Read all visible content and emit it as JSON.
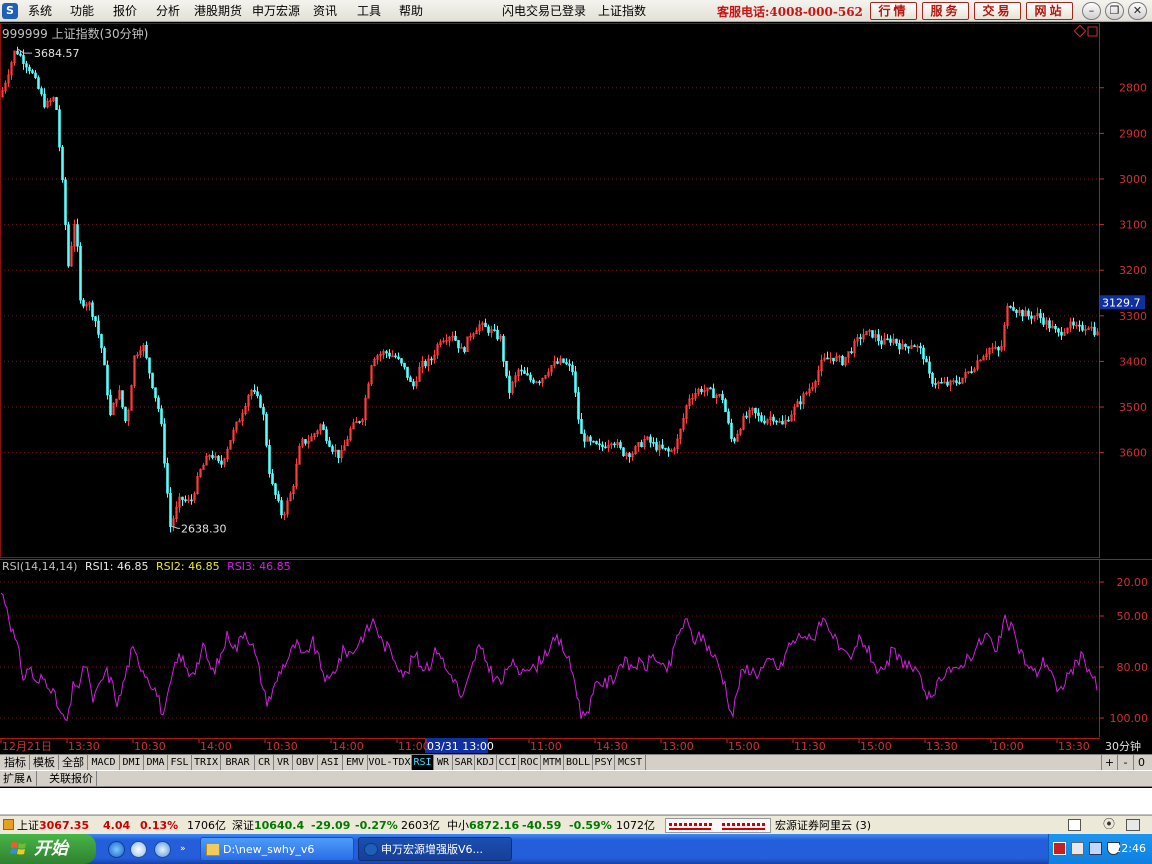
{
  "menubar": {
    "items": [
      "系统",
      "功能",
      "报价",
      "分析",
      "港股期货",
      "申万宏源",
      "资讯",
      "工具",
      "帮助"
    ],
    "status_login": "闪电交易已登录",
    "status_index": "上证指数",
    "hotline": "客服电话:4008-000-562",
    "buttons": [
      "行情",
      "服务",
      "交易",
      "网站"
    ]
  },
  "chart": {
    "title": "999999 上证指数(30分钟)",
    "high_label": "3684.57",
    "low_label": "2638.30",
    "last_price": "3129.7",
    "y_ticks": [
      "3600",
      "3500",
      "3400",
      "3300",
      "3200",
      "3100",
      "3000",
      "2900",
      "2800"
    ]
  },
  "chart_data": [
    {
      "type": "candlestick",
      "title": "999999 上证指数(30分钟)",
      "ylim": [
        2580,
        3720
      ],
      "y_ticks": [
        2800,
        2900,
        3000,
        3100,
        3200,
        3300,
        3400,
        3500,
        3600
      ],
      "annotations": [
        {
          "label": "3684.57",
          "value": 3684.57
        },
        {
          "label": "2638.30",
          "value": 2638.3
        }
      ],
      "last_value": 3129.7,
      "points": [
        [
          0,
          3580
        ],
        [
          15,
          3684.57
        ],
        [
          30,
          3640
        ],
        [
          45,
          3560
        ],
        [
          55,
          3580
        ],
        [
          62,
          3390
        ],
        [
          68,
          3210
        ],
        [
          75,
          3320
        ],
        [
          80,
          3130
        ],
        [
          88,
          3130
        ],
        [
          95,
          3090
        ],
        [
          102,
          3020
        ],
        [
          110,
          2880
        ],
        [
          118,
          2940
        ],
        [
          126,
          2860
        ],
        [
          134,
          3010
        ],
        [
          142,
          3040
        ],
        [
          152,
          2950
        ],
        [
          160,
          2880
        ],
        [
          170,
          2638.3
        ],
        [
          180,
          2700
        ],
        [
          190,
          2690
        ],
        [
          200,
          2760
        ],
        [
          210,
          2800
        ],
        [
          220,
          2770
        ],
        [
          230,
          2830
        ],
        [
          240,
          2880
        ],
        [
          250,
          2940
        ],
        [
          262,
          2900
        ],
        [
          270,
          2740
        ],
        [
          282,
          2660
        ],
        [
          292,
          2720
        ],
        [
          300,
          2820
        ],
        [
          310,
          2830
        ],
        [
          320,
          2860
        ],
        [
          332,
          2810
        ],
        [
          340,
          2790
        ],
        [
          350,
          2850
        ],
        [
          362,
          2880
        ],
        [
          372,
          3010
        ],
        [
          385,
          3020
        ],
        [
          395,
          3010
        ],
        [
          405,
          2980
        ],
        [
          412,
          2940
        ],
        [
          420,
          2990
        ],
        [
          430,
          3000
        ],
        [
          440,
          3050
        ],
        [
          452,
          3060
        ],
        [
          462,
          3020
        ],
        [
          470,
          3060
        ],
        [
          478,
          3080
        ],
        [
          488,
          3070
        ],
        [
          500,
          3050
        ],
        [
          508,
          2930
        ],
        [
          518,
          2980
        ],
        [
          530,
          2960
        ],
        [
          540,
          2960
        ],
        [
          550,
          2990
        ],
        [
          562,
          3000
        ],
        [
          572,
          2980
        ],
        [
          580,
          2840
        ],
        [
          590,
          2820
        ],
        [
          600,
          2810
        ],
        [
          612,
          2830
        ],
        [
          622,
          2800
        ],
        [
          632,
          2800
        ],
        [
          645,
          2830
        ],
        [
          658,
          2810
        ],
        [
          670,
          2800
        ],
        [
          678,
          2830
        ],
        [
          688,
          2920
        ],
        [
          700,
          2940
        ],
        [
          712,
          2930
        ],
        [
          722,
          2920
        ],
        [
          732,
          2820
        ],
        [
          742,
          2870
        ],
        [
          752,
          2890
        ],
        [
          762,
          2870
        ],
        [
          772,
          2880
        ],
        [
          782,
          2860
        ],
        [
          792,
          2890
        ],
        [
          802,
          2920
        ],
        [
          812,
          2950
        ],
        [
          822,
          3000
        ],
        [
          832,
          3010
        ],
        [
          842,
          3000
        ],
        [
          852,
          3030
        ],
        [
          862,
          3060
        ],
        [
          872,
          3060
        ],
        [
          882,
          3040
        ],
        [
          892,
          3050
        ],
        [
          902,
          3030
        ],
        [
          912,
          3040
        ],
        [
          922,
          3020
        ],
        [
          930,
          2960
        ],
        [
          940,
          2950
        ],
        [
          950,
          2950
        ],
        [
          960,
          2960
        ],
        [
          970,
          2980
        ],
        [
          980,
          3010
        ],
        [
          990,
          3030
        ],
        [
          1000,
          3020
        ],
        [
          1008,
          3130
        ],
        [
          1018,
          3110
        ],
        [
          1028,
          3100
        ],
        [
          1038,
          3100
        ],
        [
          1048,
          3080
        ],
        [
          1058,
          3060
        ],
        [
          1068,
          3080
        ],
        [
          1078,
          3070
        ],
        [
          1088,
          3080
        ],
        [
          1097,
          3060
        ]
      ]
    },
    {
      "type": "line",
      "title": "RSI(14,14,14)",
      "ylim": [
        10,
        110
      ],
      "y_ticks": [
        20,
        50,
        80,
        100
      ],
      "series": [
        {
          "name": "RSI1",
          "color": "#d020e0"
        }
      ],
      "points": [
        [
          0,
          95
        ],
        [
          6,
          88
        ],
        [
          12,
          72
        ],
        [
          18,
          60
        ],
        [
          24,
          42
        ],
        [
          30,
          52
        ],
        [
          36,
          38
        ],
        [
          42,
          44
        ],
        [
          50,
          40
        ],
        [
          56,
          30
        ],
        [
          62,
          20
        ],
        [
          68,
          18
        ],
        [
          74,
          42
        ],
        [
          80,
          38
        ],
        [
          86,
          55
        ],
        [
          92,
          30
        ],
        [
          98,
          36
        ],
        [
          106,
          48
        ],
        [
          112,
          40
        ],
        [
          118,
          28
        ],
        [
          124,
          42
        ],
        [
          132,
          60
        ],
        [
          140,
          52
        ],
        [
          148,
          44
        ],
        [
          156,
          36
        ],
        [
          164,
          20
        ],
        [
          172,
          44
        ],
        [
          180,
          58
        ],
        [
          188,
          46
        ],
        [
          196,
          50
        ],
        [
          204,
          62
        ],
        [
          212,
          46
        ],
        [
          220,
          55
        ],
        [
          228,
          70
        ],
        [
          236,
          60
        ],
        [
          244,
          72
        ],
        [
          252,
          64
        ],
        [
          260,
          46
        ],
        [
          266,
          30
        ],
        [
          272,
          34
        ],
        [
          280,
          48
        ],
        [
          288,
          55
        ],
        [
          296,
          64
        ],
        [
          304,
          54
        ],
        [
          312,
          66
        ],
        [
          320,
          52
        ],
        [
          328,
          40
        ],
        [
          336,
          50
        ],
        [
          344,
          60
        ],
        [
          352,
          58
        ],
        [
          360,
          66
        ],
        [
          368,
          72
        ],
        [
          374,
          78
        ],
        [
          382,
          64
        ],
        [
          390,
          60
        ],
        [
          398,
          52
        ],
        [
          406,
          44
        ],
        [
          414,
          58
        ],
        [
          422,
          50
        ],
        [
          430,
          52
        ],
        [
          438,
          62
        ],
        [
          446,
          48
        ],
        [
          454,
          44
        ],
        [
          462,
          30
        ],
        [
          470,
          45
        ],
        [
          478,
          62
        ],
        [
          486,
          54
        ],
        [
          494,
          44
        ],
        [
          502,
          40
        ],
        [
          510,
          54
        ],
        [
          518,
          46
        ],
        [
          526,
          52
        ],
        [
          534,
          48
        ],
        [
          542,
          56
        ],
        [
          550,
          62
        ],
        [
          558,
          66
        ],
        [
          566,
          58
        ],
        [
          574,
          44
        ],
        [
          582,
          20
        ],
        [
          590,
          28
        ],
        [
          598,
          42
        ],
        [
          606,
          40
        ],
        [
          614,
          44
        ],
        [
          622,
          54
        ],
        [
          630,
          50
        ],
        [
          638,
          52
        ],
        [
          646,
          50
        ],
        [
          654,
          58
        ],
        [
          662,
          48
        ],
        [
          670,
          50
        ],
        [
          678,
          70
        ],
        [
          686,
          77
        ],
        [
          694,
          66
        ],
        [
          702,
          68
        ],
        [
          710,
          60
        ],
        [
          718,
          52
        ],
        [
          726,
          38
        ],
        [
          732,
          20
        ],
        [
          740,
          44
        ],
        [
          748,
          50
        ],
        [
          756,
          46
        ],
        [
          764,
          50
        ],
        [
          772,
          54
        ],
        [
          780,
          48
        ],
        [
          788,
          62
        ],
        [
          796,
          66
        ],
        [
          804,
          70
        ],
        [
          812,
          64
        ],
        [
          820,
          78
        ],
        [
          828,
          76
        ],
        [
          836,
          64
        ],
        [
          844,
          56
        ],
        [
          852,
          54
        ],
        [
          860,
          68
        ],
        [
          868,
          60
        ],
        [
          876,
          50
        ],
        [
          884,
          44
        ],
        [
          892,
          60
        ],
        [
          900,
          54
        ],
        [
          908,
          52
        ],
        [
          916,
          46
        ],
        [
          924,
          38
        ],
        [
          932,
          28
        ],
        [
          940,
          44
        ],
        [
          948,
          50
        ],
        [
          956,
          46
        ],
        [
          964,
          54
        ],
        [
          972,
          58
        ],
        [
          980,
          64
        ],
        [
          988,
          70
        ],
        [
          996,
          56
        ],
        [
          1004,
          78
        ],
        [
          1012,
          72
        ],
        [
          1020,
          60
        ],
        [
          1028,
          50
        ],
        [
          1036,
          46
        ],
        [
          1044,
          54
        ],
        [
          1052,
          48
        ],
        [
          1058,
          32
        ],
        [
          1066,
          44
        ],
        [
          1074,
          50
        ],
        [
          1082,
          56
        ],
        [
          1090,
          48
        ],
        [
          1097,
          38
        ]
      ]
    }
  ],
  "rsi": {
    "label": "RSI(14,14,14)",
    "rsi1_label": "RSI1: 46.85",
    "rsi2_label": "RSI2: 46.85",
    "rsi3_label": "RSI3: 46.85",
    "y_ticks": [
      "100.00",
      "80.00",
      "50.00",
      "20.00"
    ]
  },
  "time_axis": {
    "labels": [
      "12月21日",
      "13:30",
      "10:30",
      "14:00",
      "10:30",
      "14:00",
      "11:00",
      "03/31 13:00",
      "11:00",
      "14:30",
      "13:00",
      "15:00",
      "11:30",
      "15:00",
      "13:30",
      "10:00",
      "13:30"
    ],
    "period": "30分钟"
  },
  "indicator_tabs": [
    "指标",
    "模板",
    "全部",
    "MACD",
    "DMI",
    "DMA",
    "FSL",
    "TRIX",
    "BRAR",
    "CR",
    "VR",
    "OBV",
    "ASI",
    "EMV",
    "VOL-TDX",
    "RSI",
    "WR",
    "SAR",
    "KDJ",
    "CCI",
    "ROC",
    "MTM",
    "BOLL",
    "PSY",
    "MCST"
  ],
  "indicator_active": "RSI",
  "indicator_controls": [
    "+",
    "-",
    "0"
  ],
  "tabs2": [
    "扩展∧",
    "关联报价"
  ],
  "statusbar": {
    "sh_name": "上证",
    "sh_value": "3067.35",
    "sh_change": "4.04",
    "sh_pct": "0.13%",
    "sh_amount": "1706亿",
    "sz_name": "深证",
    "sz_value": "10640.4",
    "sz_change": "-29.09",
    "sz_pct": "-0.27%",
    "sz_amount": "2603亿",
    "zx_name": "中小",
    "zx_value": "6872.16",
    "zx_change": "-40.59",
    "zx_pct": "-0.59%",
    "zx_amount": "1072亿",
    "broker": "宏源证券阿里云 (3)"
  },
  "taskbar": {
    "start": "开始",
    "task1": "D:\\new_swhy_v6",
    "task2": "申万宏源增强版V6...",
    "time": "22:46"
  }
}
